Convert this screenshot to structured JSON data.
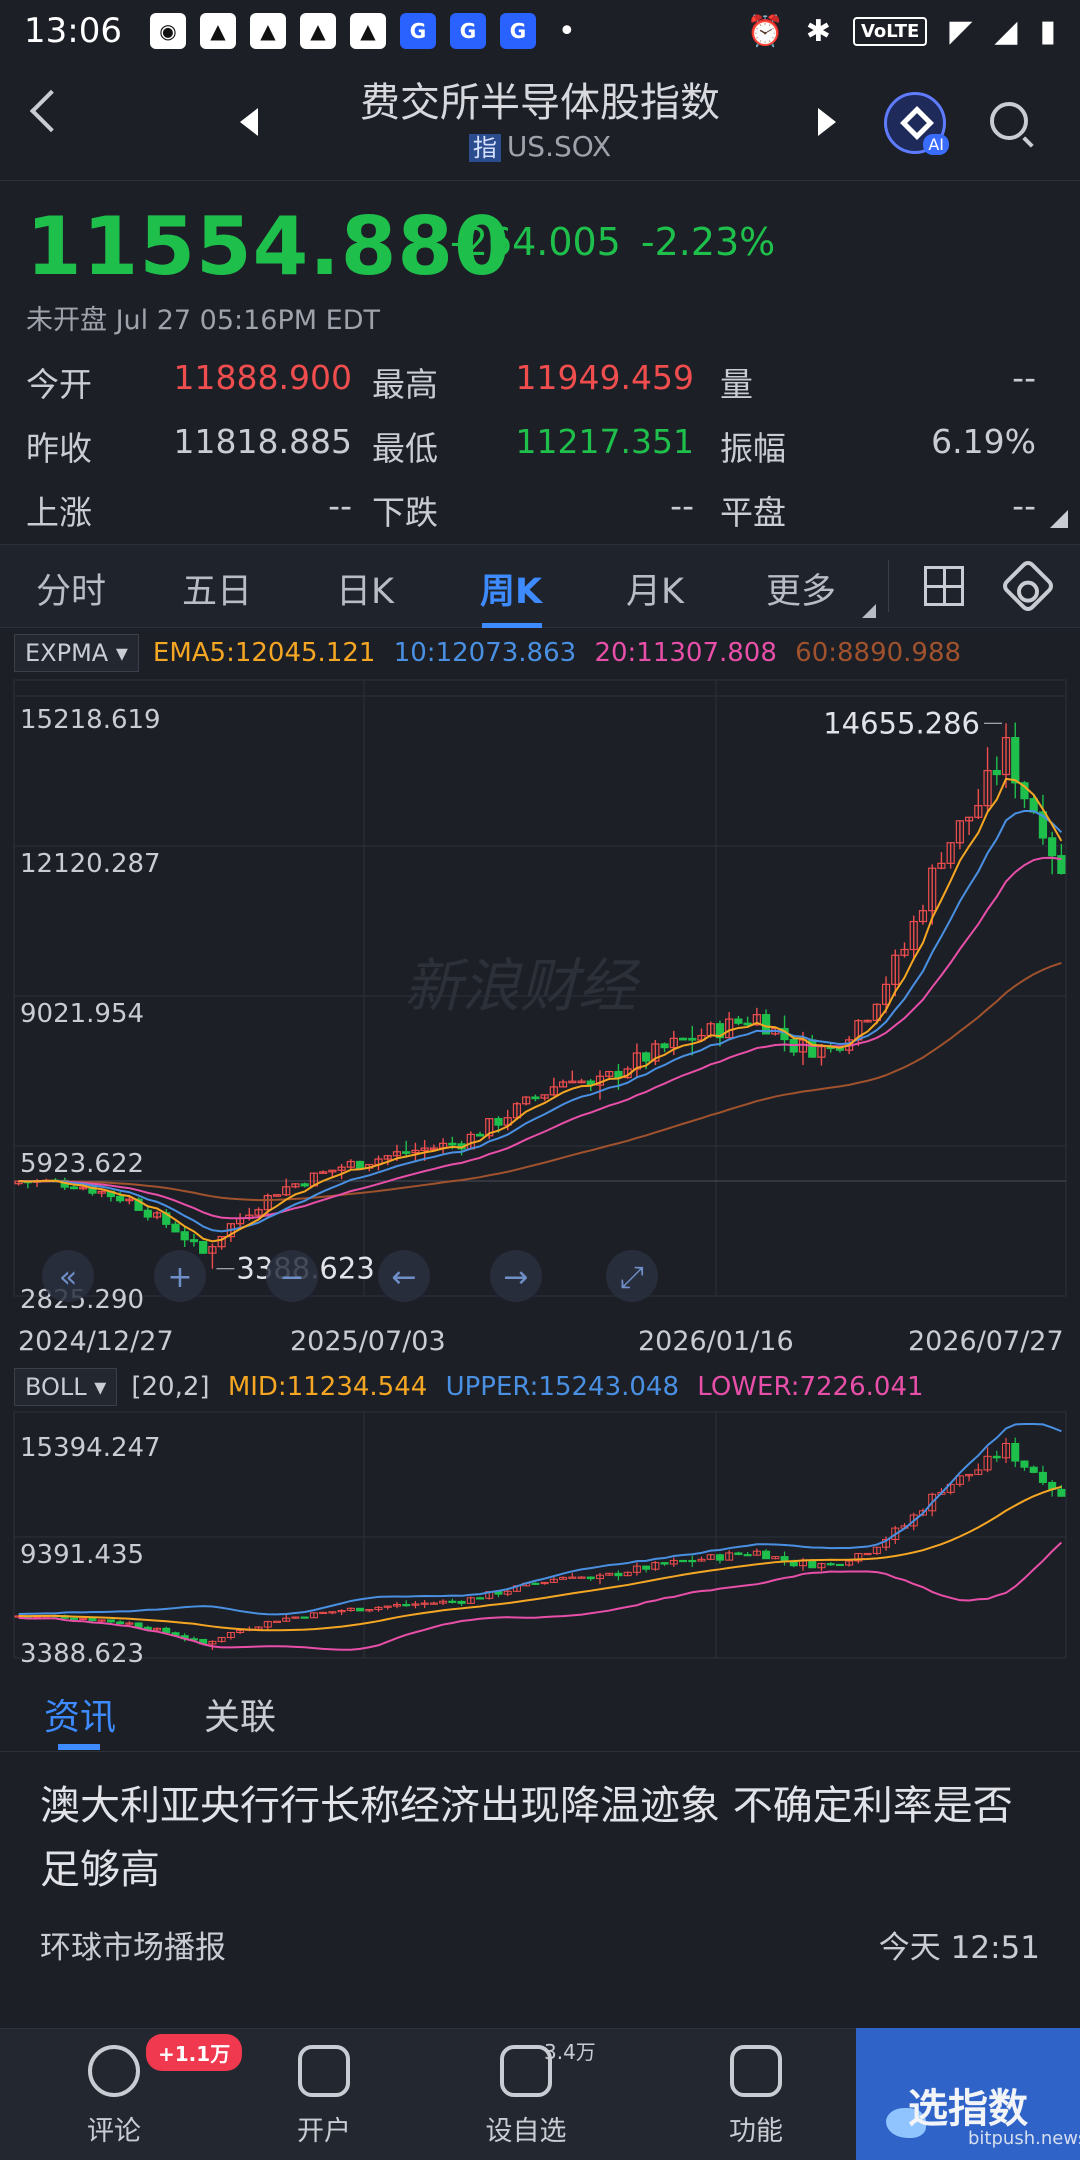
{
  "statusbar": {
    "time": "13:06",
    "volte": "VoLTE"
  },
  "header": {
    "title": "费交所半导体股指数",
    "symbol_badge": "指",
    "symbol": "US.SOX",
    "ai_label": "AI"
  },
  "quote": {
    "price": "11554.880",
    "change": "-264.005",
    "change_pct": "-2.23%",
    "market_status": "未开盘 Jul 27 05:16PM EDT"
  },
  "stats": [
    [
      {
        "label": "今开",
        "value": "11888.900",
        "color": "#f04e4e"
      },
      {
        "label": "最高",
        "value": "11949.459",
        "color": "#f04e4e"
      },
      {
        "label": "量",
        "value": "--",
        "color": "#c9ccd3"
      }
    ],
    [
      {
        "label": "昨收",
        "value": "11818.885",
        "color": "#c9ccd3"
      },
      {
        "label": "最低",
        "value": "11217.351",
        "color": "#1fbf4c"
      },
      {
        "label": "振幅",
        "value": "6.19%",
        "color": "#c9ccd3"
      }
    ],
    [
      {
        "label": "上涨",
        "value": "--",
        "color": "#c9ccd3"
      },
      {
        "label": "下跌",
        "value": "--",
        "color": "#c9ccd3"
      },
      {
        "label": "平盘",
        "value": "--",
        "color": "#c9ccd3"
      }
    ]
  ],
  "chart_tabs": [
    "分时",
    "五日",
    "日K",
    "周K",
    "月K",
    "更多"
  ],
  "active_tab": "周K",
  "main_indicator": {
    "button": "EXPMA ▾",
    "ema5": "EMA5:12045.121",
    "ema10": "10:12073.863",
    "ema20": "20:11307.808",
    "ema60": "60:8890.988"
  },
  "boll_indicator": {
    "button": "BOLL ▾",
    "params": "[20,2]",
    "mid": "MID:11234.544",
    "upper": "UPPER:15243.048",
    "lower": "LOWER:7226.041"
  },
  "watermark": "新浪财经",
  "chart_controls": [
    "«",
    "+",
    "−",
    "←",
    "→",
    "⤢"
  ],
  "colors": {
    "up": "#f04e4e",
    "down": "#1fbf4c",
    "ema5": "#f5a623",
    "ema10": "#4a90e2",
    "ema20": "#e84fa8",
    "ema60": "#a0522d",
    "accent": "#3d8bff"
  },
  "chart_data": [
    {
      "type": "candlestick",
      "y_ticks": [
        "15218.619",
        "12120.287",
        "9021.954",
        "5923.622",
        "2825.290"
      ],
      "ylim": [
        2825.29,
        15218.619
      ],
      "x_ticks": [
        "2024/12/27",
        "2025/07/03",
        "2026/01/16",
        "2026/07/27"
      ],
      "annotations": {
        "max": "14655.286",
        "min": "3388.623"
      },
      "anchors": [
        [
          0,
          5200
        ],
        [
          6,
          5150
        ],
        [
          12,
          4800
        ],
        [
          17,
          4200
        ],
        [
          20,
          3700
        ],
        [
          23,
          4300
        ],
        [
          28,
          5000
        ],
        [
          35,
          5500
        ],
        [
          42,
          5800
        ],
        [
          48,
          6000
        ],
        [
          55,
          6800
        ],
        [
          60,
          7400
        ],
        [
          62,
          7100
        ],
        [
          66,
          7600
        ],
        [
          72,
          8100
        ],
        [
          80,
          8600
        ],
        [
          84,
          8000
        ],
        [
          88,
          7900
        ],
        [
          92,
          8700
        ],
        [
          96,
          10000
        ],
        [
          100,
          12000
        ],
        [
          104,
          13000
        ],
        [
          107,
          14100
        ],
        [
          109,
          13200
        ],
        [
          111,
          12600
        ],
        [
          113,
          11555
        ]
      ],
      "series": [
        {
          "name": "EMA5",
          "values": "ema5"
        },
        {
          "name": "10",
          "values": "ema10"
        },
        {
          "name": "20",
          "values": "ema20"
        },
        {
          "name": "60",
          "values": "ema60"
        }
      ]
    },
    {
      "type": "candlestick",
      "y_ticks": [
        "15394.247",
        "9391.435",
        "3388.623"
      ],
      "ylim": [
        3388.623,
        15394.247
      ],
      "series": [
        {
          "name": "MID",
          "values": "mid"
        },
        {
          "name": "UPPER",
          "values": "upper"
        },
        {
          "name": "LOWER",
          "values": "lower"
        }
      ]
    }
  ],
  "news_tabs": [
    "资讯",
    "关联"
  ],
  "news": {
    "title": "澳大利亚央行行长称经济出现降温迹象 不确定利率是否足够高",
    "source": "环球市场播报",
    "time": "今天 12:51"
  },
  "tabbar": {
    "items": [
      "评论",
      "开户",
      "设自选",
      "功能"
    ],
    "badge": "+1.1万",
    "badge2": "3.4万",
    "promo": "选指数",
    "promo_sub": "bitpush.news"
  }
}
